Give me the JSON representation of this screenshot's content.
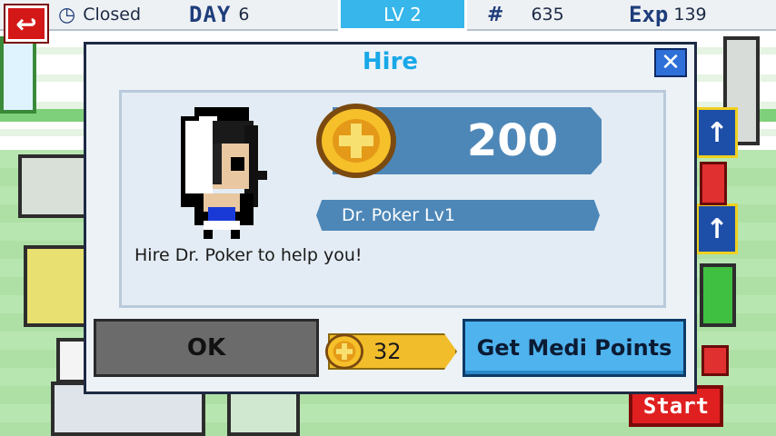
{
  "hud": {
    "status": "Closed",
    "day_label": "DAY",
    "day_value": "6",
    "level": "LV 2",
    "money_icon": "#",
    "money": "635",
    "exp_label": "Exp",
    "exp_value": "139"
  },
  "scene": {
    "start_label": "Start",
    "back_icon": "↩"
  },
  "dialog": {
    "title": "Hire",
    "close_label": "✕",
    "cost": "200",
    "doctor_name": "Dr. Poker Lv1",
    "message": "Hire Dr. Poker to help you!",
    "ok_label": "OK",
    "medi_points": "32",
    "get_points_label": "Get Medi Points"
  },
  "colors": {
    "title": "#18a8e8",
    "panel_bar": "#4d87b8",
    "coin": "#f2bd2a",
    "get_button": "#4fb3ee",
    "ok_button": "#6b6b6b"
  }
}
